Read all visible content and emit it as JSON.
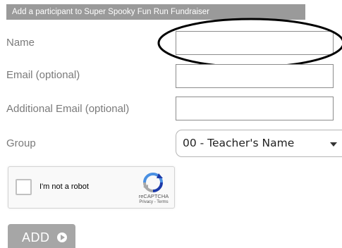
{
  "form": {
    "title": "Add a participant to Super Spooky Fun Run Fundraiser",
    "name_label": "Name",
    "name_value": "",
    "email_label": "Email (optional)",
    "email_value": "",
    "additional_email_label": "Additional Email (optional)",
    "additional_email_value": "",
    "group_label": "Group",
    "group_selected": "00 - Teacher's Name"
  },
  "recaptcha": {
    "checkbox_label": "I'm not a robot",
    "brand": "reCAPTCHA",
    "links": "Privacy - Terms"
  },
  "actions": {
    "add_label": "ADD"
  },
  "colors": {
    "header_bg": "#9a9a9a",
    "button_bg": "#a6a6a6",
    "label_text": "#7a7a7a"
  },
  "icons": {
    "dropdown": "chevron-down-icon",
    "add": "play-circle-icon",
    "captcha": "recaptcha-logo-icon"
  }
}
